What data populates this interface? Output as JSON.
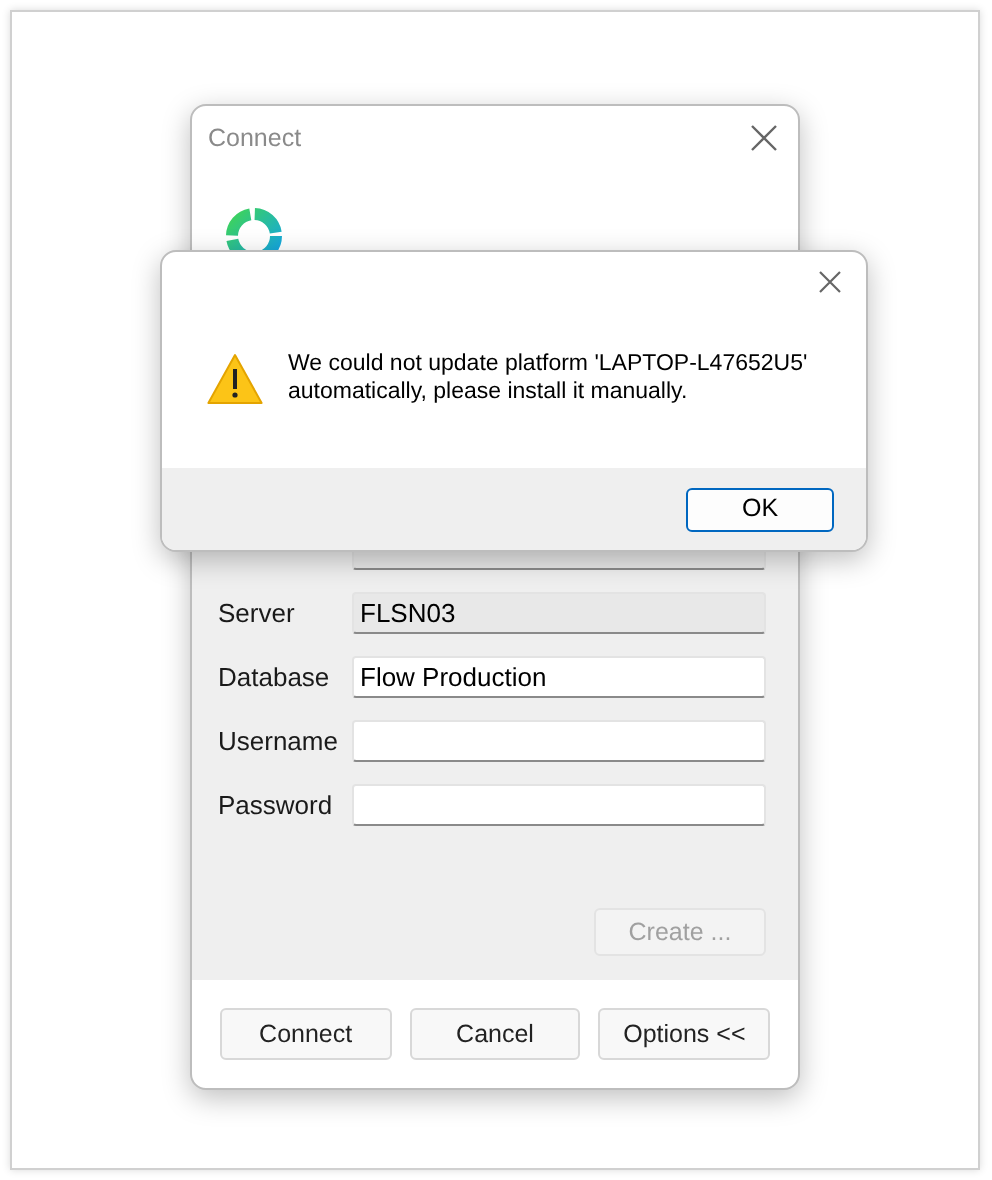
{
  "connect_dialog": {
    "title": "Connect",
    "fields": [
      {
        "readonly": true
      },
      {
        "label": "Server",
        "value": "FLSN03",
        "readonly": true
      },
      {
        "label": "Database",
        "value": "Flow Production",
        "readonly": false
      },
      {
        "label": "Username",
        "readonly": false
      },
      {
        "label": "Password",
        "readonly": false
      }
    ],
    "create_button": {
      "label": "Create ...",
      "disabled": true
    },
    "buttons": [
      {
        "label": "Connect"
      },
      {
        "label": "Cancel"
      },
      {
        "label": "Options <<"
      }
    ]
  },
  "alert": {
    "message": "We could not update platform 'LAPTOP-L47652U5' automatically, please install it manually.",
    "button": "OK"
  }
}
